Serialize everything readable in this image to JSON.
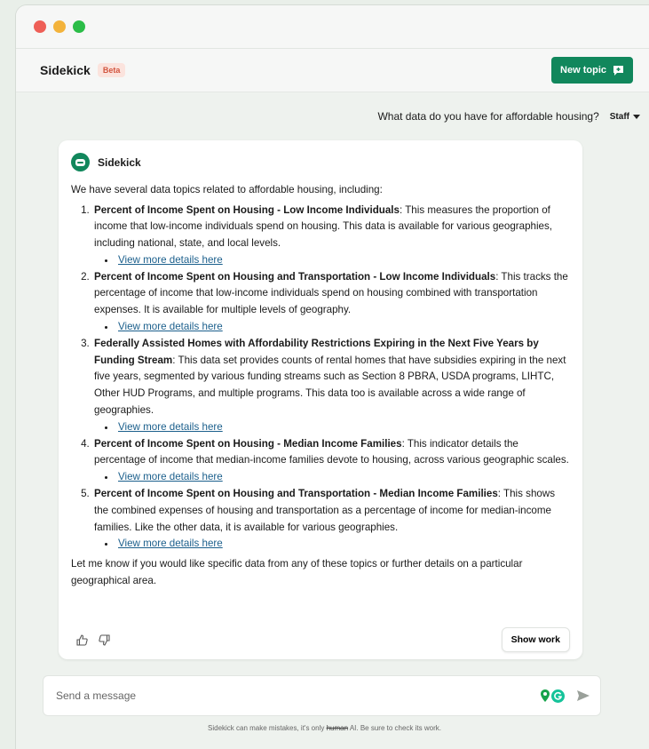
{
  "window": {
    "traffic_lights": {
      "close": "#ee5f57",
      "minimize": "#f3b33b",
      "maximize": "#2bbd47"
    }
  },
  "header": {
    "brand": "Sidekick",
    "badge": "Beta",
    "new_topic_label": "New topic",
    "accent": "#11875c"
  },
  "user_message": {
    "text": "What data do you have for affordable housing?",
    "role_label": "Staff"
  },
  "response": {
    "sender": "Sidekick",
    "intro": "We have several data topics related to affordable housing, including:",
    "items": [
      {
        "number": "1.",
        "title": "Percent of Income Spent on Housing - Low Income Individuals",
        "text": ": This measures the proportion of income that low-income individuals spend on housing. This data is available for various geographies, including national, state, and local levels.",
        "link": "View more details here"
      },
      {
        "number": "2.",
        "title": "Percent of Income Spent on Housing and Transportation - Low Income Individuals",
        "text": ": This tracks the percentage of income that low-income individuals spend on housing combined with transportation expenses. It is available for multiple levels of geography.",
        "link": "View more details here"
      },
      {
        "number": "3.",
        "title": "Federally Assisted Homes with Affordability Restrictions Expiring in the Next Five Years by Funding Stream",
        "text": ": This data set provides counts of rental homes that have subsidies expiring in the next five years, segmented by various funding streams such as Section 8 PBRA, USDA programs, LIHTC, Other HUD Programs, and multiple programs. This data too is available across a wide range of geographies.",
        "link": "View more details here"
      },
      {
        "number": "4.",
        "title": "Percent of Income Spent on Housing - Median Income Families",
        "text": ": This indicator details the percentage of income that median-income families devote to housing, across various geographic scales.",
        "link": "View more details here"
      },
      {
        "number": "5.",
        "title": "Percent of Income Spent on Housing and Transportation - Median Income Families",
        "text": ": This shows the combined expenses of housing and transportation as a percentage of income for median-income families. Like the other data, it is available for various geographies.",
        "link": "View more details here"
      }
    ],
    "outro": "Let me know if you would like specific data from any of these topics or further details on a particular geographical area.",
    "show_work_label": "Show work"
  },
  "composer": {
    "placeholder": "Send a message"
  },
  "disclaimer": {
    "before": "Sidekick can make mistakes, it's only ",
    "struck": "human",
    "after": " AI. Be sure to check its work."
  }
}
